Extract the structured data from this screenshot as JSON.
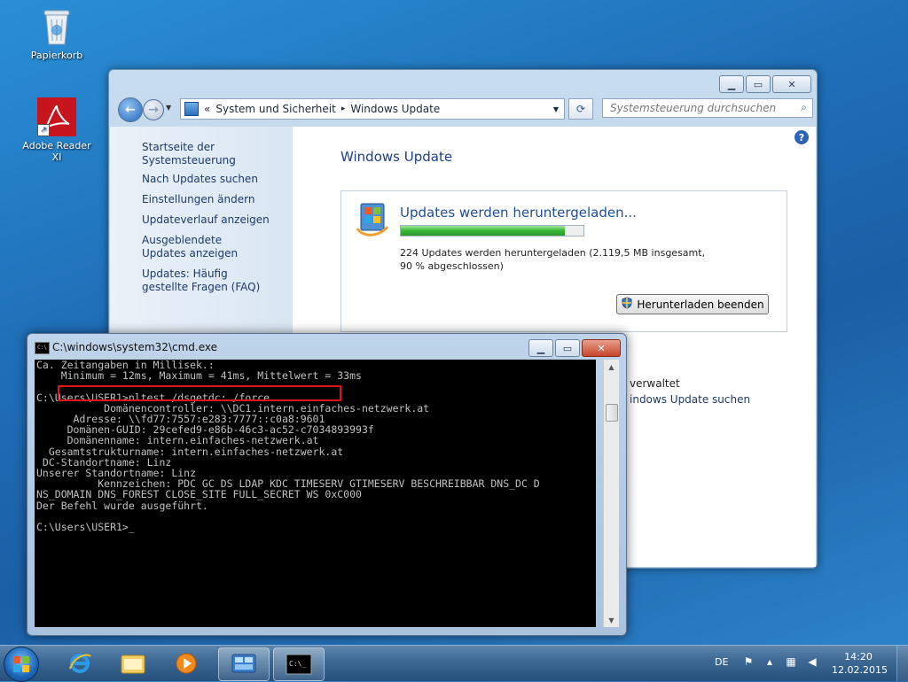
{
  "desktop": {
    "icons": [
      {
        "label": "Papierkorb",
        "icon": "recycle-bin-icon"
      },
      {
        "label": "Adobe Reader XI",
        "icon": "adobe-reader-icon"
      }
    ]
  },
  "control_panel": {
    "address": {
      "prefix": "«",
      "crumb1": "System und Sicherheit",
      "separator": "▸",
      "crumb2": "Windows Update"
    },
    "search_placeholder": "Systemsteuerung durchsuchen",
    "sidebar": {
      "home": "Startseite der Systemsteuerung",
      "items": [
        "Nach Updates suchen",
        "Einstellungen ändern",
        "Updateverlauf anzeigen",
        "Ausgeblendete Updates anzeigen",
        "Updates: Häufig gestellte Fragen (FAQ)"
      ]
    },
    "title": "Windows Update",
    "panel": {
      "heading": "Updates werden heruntergeladen...",
      "progress_percent": 90,
      "description": "224 Updates werden heruntergeladen (2.119,5 MB insgesamt, 90 % abgeschlossen)",
      "stop_button": "Herunterladen beenden"
    },
    "partial_text": {
      "managed": "verwaltet",
      "search_updates": "indows Update suchen"
    }
  },
  "cmd": {
    "title": "C:\\windows\\system32\\cmd.exe",
    "lines": [
      "Ca. Zeitangaben in Millisek.:",
      "    Minimum = 12ms, Maximum = 41ms, Mittelwert = 33ms",
      "",
      "C:\\Users\\USER1>nltest /dsgetdc: /force",
      "           Domänencontroller: \\\\DC1.intern.einfaches-netzwerk.at",
      "      Adresse: \\\\fd77:7557:e283:7777::c0a8:9601",
      "     Domänen-GUID: 29cefed9-e86b-46c3-ac52-c7034893993f",
      "     Domänenname: intern.einfaches-netzwerk.at",
      "  Gesamtstrukturname: intern.einfaches-netzwerk.at",
      " DC-Standortname: Linz",
      "Unserer Standortname: Linz",
      "          Kennzeichen: PDC GC DS LDAP KDC TIMESERV GTIMESERV BESCHREIBBAR DNS_DC D",
      "NS_DOMAIN DNS_FOREST CLOSE_SITE FULL_SECRET WS 0xC000",
      "Der Befehl wurde ausgeführt.",
      "",
      "C:\\Users\\USER1>_"
    ]
  },
  "taskbar": {
    "pinned": [
      "start-orb",
      "internet-explorer-icon",
      "file-explorer-icon",
      "media-player-icon",
      "control-panel-icon",
      "cmd-icon"
    ],
    "language": "DE",
    "time": "14:20",
    "date": "12.02.2015"
  },
  "colors": {
    "highlight_box": "#e0141c",
    "progress_fill": "#37b534",
    "link": "#1e3a68",
    "title_blue": "#1e3f8a"
  }
}
